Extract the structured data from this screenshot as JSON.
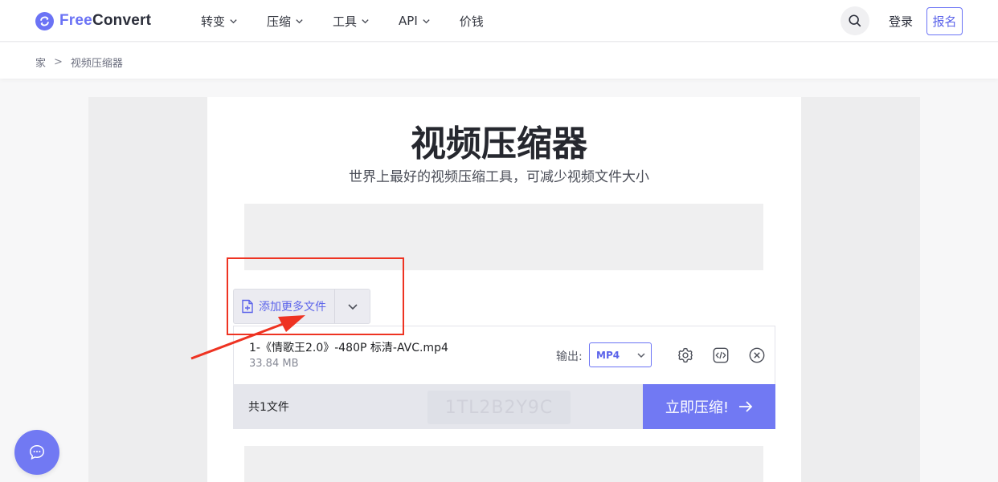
{
  "brand": {
    "name_prefix": "Free",
    "name_suffix": "Convert",
    "accent": "#6b73f5"
  },
  "nav": {
    "items": [
      {
        "label": "转变",
        "has_dropdown": true
      },
      {
        "label": "压缩",
        "has_dropdown": true
      },
      {
        "label": "工具",
        "has_dropdown": true
      },
      {
        "label": "API",
        "has_dropdown": true
      },
      {
        "label": "价钱",
        "has_dropdown": false
      }
    ],
    "search_icon": "search-icon",
    "login_label": "登录",
    "signup_label": "报名"
  },
  "breadcrumb": {
    "home": "家",
    "separator": ">",
    "current": "视频压缩器"
  },
  "hero": {
    "title": "视频压缩器",
    "subtitle": "世界上最好的视频压缩工具，可减少视频文件大小"
  },
  "uploader": {
    "add_more_label": "添加更多文件",
    "add_icon": "file-plus-icon",
    "dropdown_icon": "chevron-down-icon"
  },
  "file": {
    "name": "1-《情歌王2.0》-480P 标清-AVC.mp4",
    "size": "33.84 MB",
    "output_label": "输出:",
    "output_format": "MP4",
    "actions": [
      "gear-icon",
      "code-icon",
      "close-circle-icon"
    ]
  },
  "footer": {
    "file_count": "共1文件",
    "watermark": "1TL2B2Y9C",
    "compress_label": "立即压缩!",
    "compress_color": "#7179f3"
  },
  "annotation": {
    "highlight_color": "#ee3322"
  },
  "chat": {
    "icon": "chat-bubble-icon"
  }
}
